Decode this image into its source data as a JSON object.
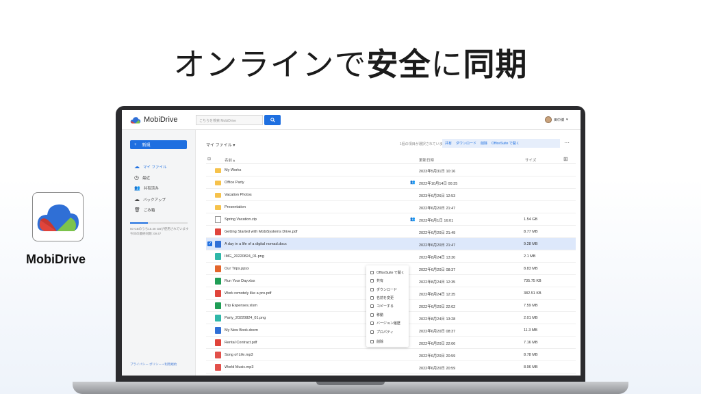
{
  "headline": {
    "part1": "オンラインで",
    "part2": "安全",
    "part3": "に",
    "part4": "同期"
  },
  "brand": {
    "name": "MobiDrive"
  },
  "app": {
    "logo_text": "MobiDrive",
    "search_placeholder": "こちらを検索 MobiDrive",
    "user_name": "田中博",
    "new_button": "新規",
    "nav": [
      {
        "label": "マイ ファイル",
        "icon": "cloud-icon",
        "active": true
      },
      {
        "label": "最近",
        "icon": "clock-icon"
      },
      {
        "label": "共有済み",
        "icon": "people-icon"
      },
      {
        "label": "バックアップ",
        "icon": "cloud-upload-icon"
      },
      {
        "label": "ごみ箱",
        "icon": "trash-icon"
      }
    ],
    "quota_text": "50 GBのうち15.48 GBが使用されています",
    "quota_text2": "今日の最終同期: 09:47",
    "quota_fraction": 0.31,
    "footer": "プライバシー ポリシー  •  利用規約",
    "breadcrumb": "マイ ファイル",
    "selection_info": "1個の項目が選択されています",
    "actions": [
      "共有",
      "ダウンロード",
      "削除",
      "OfficeSuite で開く"
    ],
    "columns": {
      "name": "名前",
      "modified": "更新日時",
      "size": "サイズ"
    },
    "files": [
      {
        "name": "My Works",
        "type": "folder",
        "modified": "2023年5月31日 10:16",
        "size": "",
        "shared": false
      },
      {
        "name": "Office Party",
        "type": "folder",
        "modified": "2022年10月14日 00:35",
        "size": "",
        "shared": true
      },
      {
        "name": "Vacation Photos",
        "type": "folder",
        "modified": "2023年6月26日 12:53",
        "size": "",
        "shared": false
      },
      {
        "name": "Presentation",
        "type": "folder",
        "modified": "2022年6月20日 21:47",
        "size": "",
        "shared": false
      },
      {
        "name": "Spring Vacation.zip",
        "type": "zip",
        "modified": "2023年6月1日 16:01",
        "size": "1.54 GB",
        "shared": true
      },
      {
        "name": "Getting Started with MobiSystems Drive.pdf",
        "type": "pdf",
        "modified": "2022年6月20日 21:49",
        "size": "8.77 MB",
        "shared": false
      },
      {
        "name": "A day in a life of a digital nomad.docx",
        "type": "doc",
        "modified": "2022年6月20日 21:47",
        "size": "9.28 MB",
        "shared": false,
        "selected": true
      },
      {
        "name": "IMG_20220824_01.png",
        "type": "img",
        "modified": "2022年8月24日 13:30",
        "size": "2.1 MB",
        "shared": false
      },
      {
        "name": "Our Trips.ppsx",
        "type": "ppt",
        "modified": "2022年6月20日 08:37",
        "size": "8.83 MB",
        "shared": false
      },
      {
        "name": "Run Your Day.xlsx",
        "type": "xls",
        "modified": "2022年8月24日 12:35",
        "size": "735.75 KB",
        "shared": false
      },
      {
        "name": "Work remotely like a pro.pdf",
        "type": "pdf",
        "modified": "2022年8月24日 12:35",
        "size": "382.51 KB",
        "shared": false
      },
      {
        "name": "Trip Expenses.xlsm",
        "type": "xls",
        "modified": "2022年6月20日 22:02",
        "size": "7.59 MB",
        "shared": false
      },
      {
        "name": "Party_20220824_01.png",
        "type": "img",
        "modified": "2022年8月24日 13:28",
        "size": "2.01 MB",
        "shared": false
      },
      {
        "name": "My New Book.docm",
        "type": "doc",
        "modified": "2022年6月20日 08:37",
        "size": "11.3 MB",
        "shared": false
      },
      {
        "name": "Rental Contract.pdf",
        "type": "pdf",
        "modified": "2022年6月20日 22:06",
        "size": "7.16 MB",
        "shared": false
      },
      {
        "name": "Song of Life.mp3",
        "type": "mp3",
        "modified": "2022年6月20日 20:59",
        "size": "8.78 MB",
        "shared": false
      },
      {
        "name": "World Music.mp3",
        "type": "mp3",
        "modified": "2022年6月20日 20:59",
        "size": "8.96 MB",
        "shared": false
      }
    ],
    "context_menu": [
      "OfficeSuite で開く",
      "共有",
      "ダウンロード",
      "名前を変更",
      "コピーする",
      "移動",
      "バージョン履歴",
      "プロパティ",
      "削除"
    ]
  },
  "colors": {
    "accent": "#1e6fe0",
    "folder": "#f6c24b",
    "pdf": "#e0443b",
    "doc": "#2f6fd6",
    "xls": "#1f9d55",
    "ppt": "#e3652b",
    "img": "#2fb7a8",
    "mp3": "#e2504a"
  }
}
